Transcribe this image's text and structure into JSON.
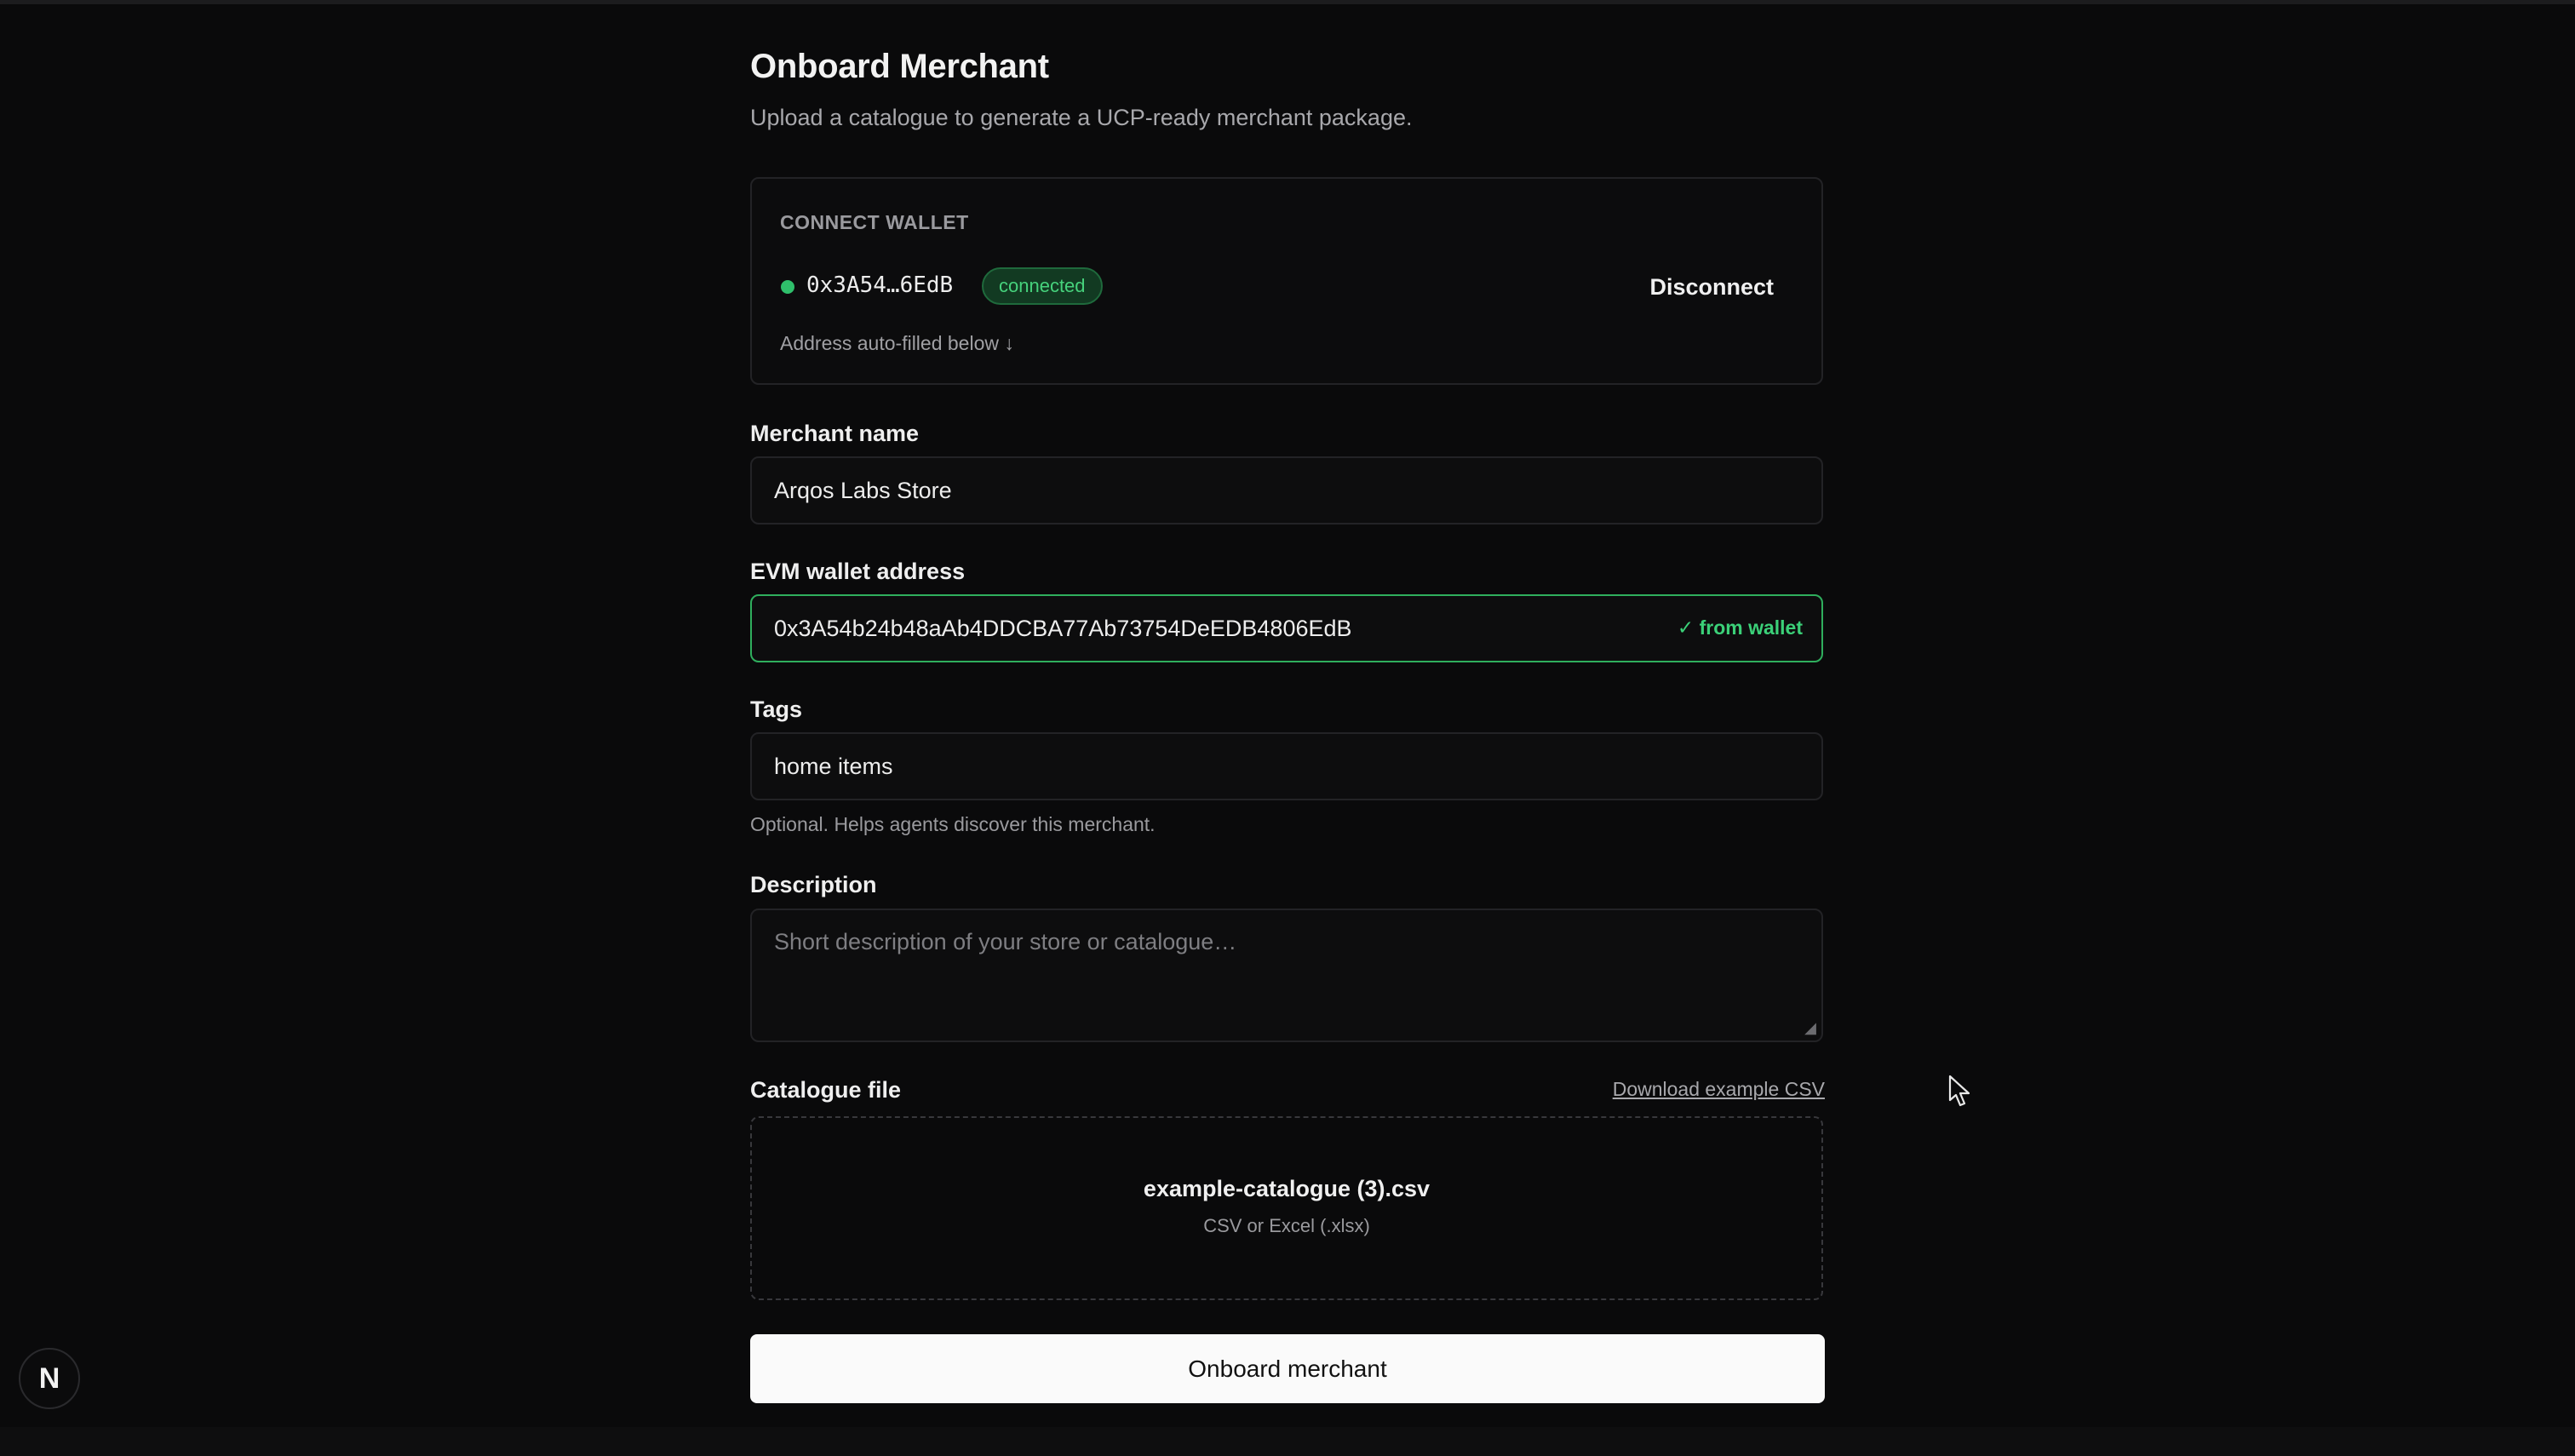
{
  "page": {
    "title": "Onboard Merchant",
    "subtitle": "Upload a catalogue to generate a UCP-ready merchant package."
  },
  "wallet": {
    "section_label": "CONNECT WALLET",
    "short_address": "0x3A54…6EdB",
    "status": "connected",
    "disconnect_label": "Disconnect",
    "autofill_note": "Address auto-filled below ↓",
    "status_color": "#2fbf6b"
  },
  "form": {
    "merchant_name": {
      "label": "Merchant name",
      "value": "Arqos Labs Store"
    },
    "evm_address": {
      "label": "EVM wallet address",
      "value": "0x3A54b24b48aAb4DDCBA77Ab73754DeEDB4806EdB",
      "badge": "✓ from wallet"
    },
    "tags": {
      "label": "Tags",
      "value": "home items",
      "helper": "Optional. Helps agents discover this merchant."
    },
    "description": {
      "label": "Description",
      "placeholder": "Short description of your store or catalogue…",
      "value": ""
    },
    "catalogue": {
      "label": "Catalogue file",
      "download_link": "Download example CSV",
      "file_name": "example-catalogue (3).csv",
      "hint": "CSV or Excel (.xlsx)"
    },
    "submit_label": "Onboard merchant"
  },
  "badge": {
    "letter": "N"
  },
  "colors": {
    "background": "#0a0a0b",
    "accent_green": "#3bd078",
    "button_bg": "#fafafa"
  }
}
